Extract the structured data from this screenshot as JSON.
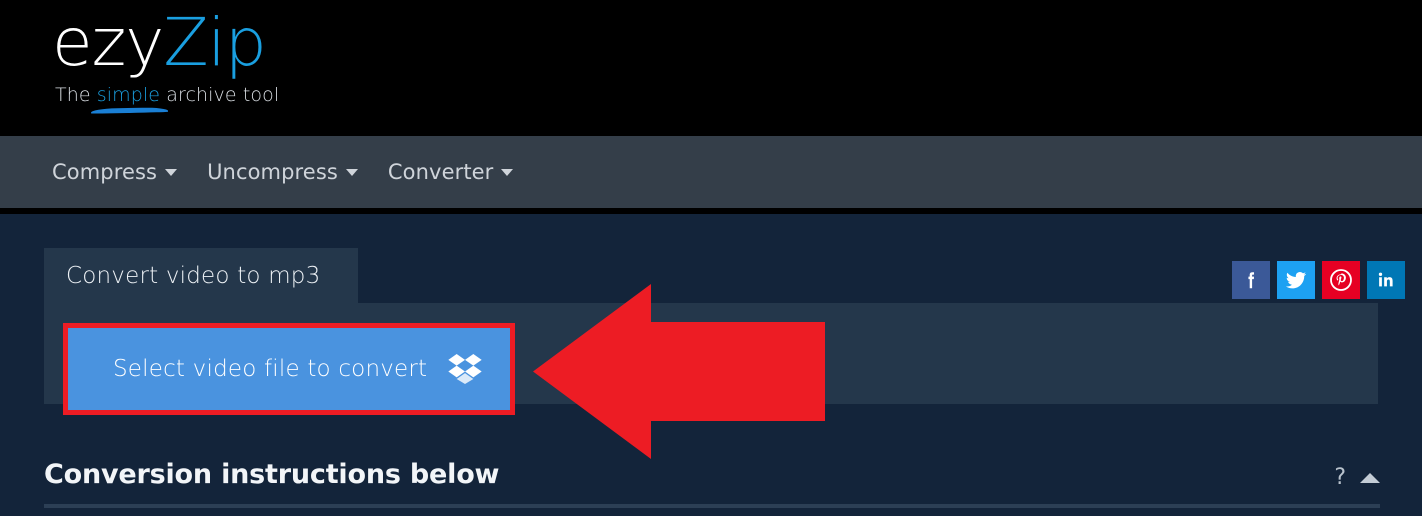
{
  "brand": {
    "name_primary": "ezy",
    "name_secondary": "Zip",
    "tagline_before": "The ",
    "tagline_highlight": "simple",
    "tagline_after": " archive tool",
    "color_accent": "#1a9fe0"
  },
  "nav": {
    "items": [
      {
        "label": "Compress",
        "icon": "chevron-down-icon"
      },
      {
        "label": "Uncompress",
        "icon": "chevron-down-icon"
      },
      {
        "label": "Converter",
        "icon": "chevron-down-icon"
      }
    ]
  },
  "main": {
    "tabs": [
      {
        "label": "Convert video to mp3",
        "active": true
      }
    ],
    "select_button": {
      "label": "Select video file to convert",
      "icon": "dropbox-icon",
      "background": "#4a93df",
      "highlight_border": "#ed1c24"
    },
    "annotation": {
      "shape": "left-arrow",
      "color": "#ed1c24"
    }
  },
  "social": {
    "items": [
      {
        "name": "facebook-share-button",
        "label": "f",
        "color": "#3b5998"
      },
      {
        "name": "twitter-share-button",
        "label": "Twitter",
        "color": "#1da1f2"
      },
      {
        "name": "pinterest-share-button",
        "label": "Pinterest",
        "color": "#e60023"
      },
      {
        "name": "linkedin-share-button",
        "label": "in",
        "color": "#0077b5"
      }
    ]
  },
  "instructions": {
    "title": "Conversion instructions below",
    "help_label": "?",
    "collapse_icon": "chevron-up-icon"
  }
}
